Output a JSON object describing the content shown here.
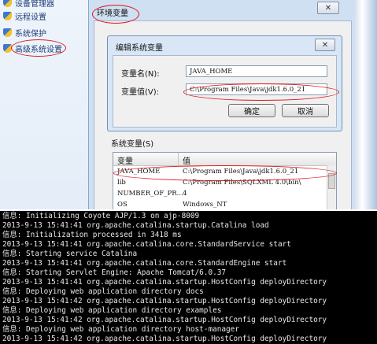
{
  "left_nav": {
    "items": [
      {
        "label": "设备管理器"
      },
      {
        "label": "远程设置"
      },
      {
        "label": "系统保护"
      },
      {
        "label": "高级系统设置"
      }
    ]
  },
  "env_window": {
    "title": "环境变量",
    "close_label": "✕",
    "faint_top_text": "..."
  },
  "edit_dialog": {
    "title": "编辑系统变量",
    "close_label": "✕",
    "name_label": "变量名(N):",
    "name_value": "JAVA_HOME",
    "value_label": "变量值(V):",
    "value_value": "C:\\Program Files\\Java\\jdk1.6.0_21",
    "ok_label": "确定",
    "cancel_label": "取消"
  },
  "system_vars": {
    "label": "系统变量(S)",
    "headers": {
      "var": "变量",
      "val": "值"
    },
    "rows": [
      {
        "var": "JAVA_HOME",
        "val": "C:\\Program Files\\Java\\jdk1.6.0_21"
      },
      {
        "var": "lib",
        "val": "C:\\Program Files\\SQLXML 4.0\\bin\\"
      },
      {
        "var": "NUMBER_OF_PR...",
        "val": "4"
      },
      {
        "var": "OS",
        "val": "Windows_NT"
      }
    ]
  },
  "console": {
    "lines": [
      "信息: Initializing Coyote AJP/1.3 on ajp-8009",
      "2013-9-13 15:41:41 org.apache.catalina.startup.Catalina load",
      "信息: Initialization processed in 3418 ms",
      "2013-9-13 15:41:41 org.apache.catalina.core.StandardService start",
      "信息: Starting service Catalina",
      "2013-9-13 15:41:41 org.apache.catalina.core.StandardEngine start",
      "信息: Starting Servlet Engine: Apache Tomcat/6.0.37",
      "2013-9-13 15:41:41 org.apache.catalina.startup.HostConfig deployDirectory",
      "信息: Deploying web application directory docs",
      "2013-9-13 15:41:42 org.apache.catalina.startup.HostConfig deployDirectory",
      "信息: Deploying web application directory examples",
      "2013-9-13 15:41:42 org.apache.catalina.startup.HostConfig deployDirectory",
      "信息: Deploying web application directory host-manager",
      "2013-9-13 15:41:42 org.apache.catalina.startup.HostConfig deployDirectory"
    ]
  },
  "colors": {
    "annotation": "#e0141b",
    "console_bg": "#000000",
    "console_fg": "#e8e8e8"
  }
}
